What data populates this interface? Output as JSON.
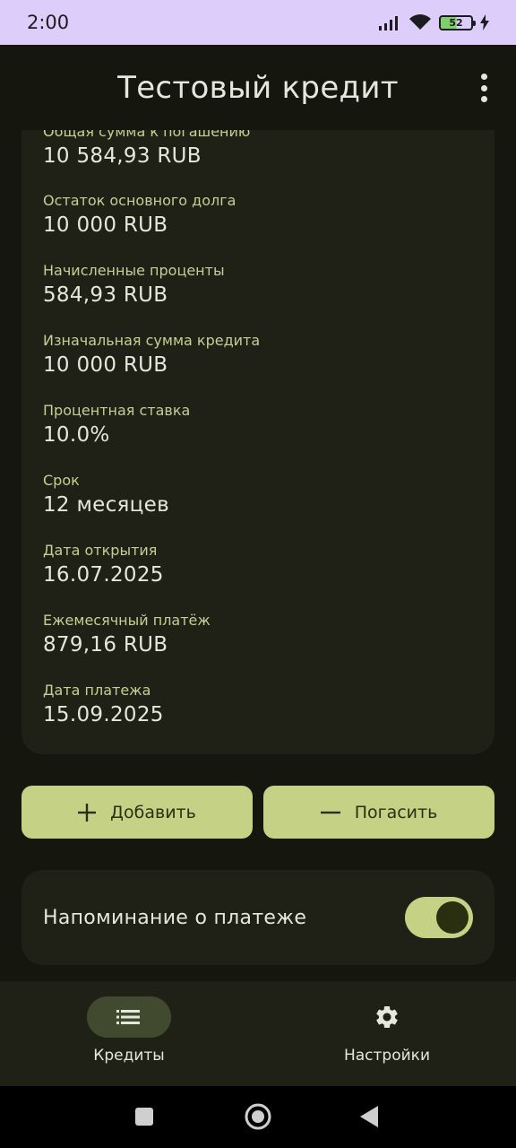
{
  "status_bar": {
    "time": "2:00",
    "battery_level": "52",
    "icons": [
      "signal-icon",
      "wifi-icon",
      "battery-icon",
      "charging-icon"
    ]
  },
  "app_bar": {
    "title": "Тестовый кредит",
    "menu_icon": "more-vert-icon"
  },
  "details": [
    {
      "label": "Общая сумма к погашению",
      "value": "10 584,93 RUB"
    },
    {
      "label": "Остаток основного долга",
      "value": "10 000 RUB"
    },
    {
      "label": "Начисленные проценты",
      "value": "584,93 RUB"
    },
    {
      "label": "Изначальная сумма кредита",
      "value": "10 000 RUB"
    },
    {
      "label": "Процентная ставка",
      "value": "10.0%"
    },
    {
      "label": "Срок",
      "value": "12 месяцев"
    },
    {
      "label": "Дата открытия",
      "value": "16.07.2025"
    },
    {
      "label": "Ежемесячный платёж",
      "value": "879,16 RUB"
    },
    {
      "label": "Дата платежа",
      "value": "15.09.2025"
    }
  ],
  "actions": {
    "add_label": "Добавить",
    "pay_label": "Погасить"
  },
  "reminder": {
    "label": "Напоминание о платеже",
    "enabled": true
  },
  "bottom_nav": {
    "items": [
      {
        "label": "Кредиты",
        "icon": "list-icon",
        "active": true
      },
      {
        "label": "Настройки",
        "icon": "gear-icon",
        "active": false
      }
    ]
  },
  "colors": {
    "background": "#15170f",
    "card": "#1f2117",
    "accent": "#c5d185",
    "label": "#c6ce92",
    "status_bar": "#dccdfa"
  }
}
